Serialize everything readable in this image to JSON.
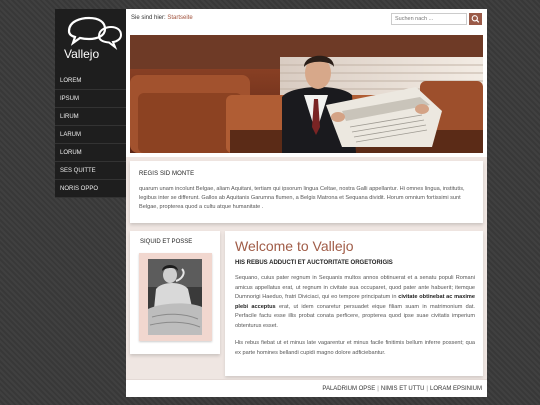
{
  "logo": {
    "text": "Vallejo"
  },
  "nav": {
    "items": [
      {
        "label": "LOREM"
      },
      {
        "label": "IPSUM"
      },
      {
        "label": "LIRUM"
      },
      {
        "label": "LARUM"
      },
      {
        "label": "LORUM"
      },
      {
        "label": "SES QUITTE"
      },
      {
        "label": "NORIS OPPO"
      }
    ]
  },
  "breadcrumb": {
    "label": "Sie sind hier:",
    "link": "Startseite"
  },
  "search": {
    "placeholder": "Suchen nach ..."
  },
  "intro": {
    "title": "REGIS SID MONTE",
    "text": "quarum unam incolunt Belgae, aliam Aquitani, tertiam qui ipsorum lingua Celtae, nostra Galli appellantur. Hi omnes lingua, institutis, legibus inter se differunt. Gallos ab Aquitanis Garumna flumen, a Belgis Matrona et Sequana dividit. Horum omnium fortissimi sunt Belgae, propterea quod a cultu atque humanitate ."
  },
  "side": {
    "title": "SIQUID ET POSSE"
  },
  "content": {
    "title": "Welcome to Vallejo",
    "subtitle": "HIS REBUS ADDUCTI ET AUCTORITATE ORGETORIGIS",
    "para1_a": "Sequano, cuius pater regnum in Sequanis multos annos obtinuerat et a senatu populi Romani amicus appellatus erat, ut regnum in civitate sua occuparet, quod pater ante habuerit; itemque Dumnorigi Haeduo, fratri Diviciaci, qui eo tempore principatum in ",
    "para1_hl": "civitate obtinebat ac maxime plebi acceptus",
    "para1_b": " erat, ut idem conaretur persuadet eique filiam suam in matrimonium dat. Perfacile factu esse illis probat conata perficere, propterea quod ipse suae civitatis imperium obtenturus esset.",
    "para2": "His rebus fiebat ut et minus late vagarentur et minus facile finitimis bellum inferre possent; qua ex parte homines bellandi cupidi magno dolore adficiebantur."
  },
  "footer": {
    "links": [
      {
        "label": "PALADRIUM OPSE"
      },
      {
        "label": "NIMIS ET UTTU"
      },
      {
        "label": "LORAM EPSINIUM"
      }
    ],
    "separator": "|"
  },
  "colors": {
    "accent": "#a05c47",
    "sidebar": "#1e1e1e",
    "band": "#efe6e2",
    "frame": "#f1d7cf"
  },
  "icons": {
    "search": "magnifier-icon",
    "logo": "speech-bubbles-icon"
  }
}
